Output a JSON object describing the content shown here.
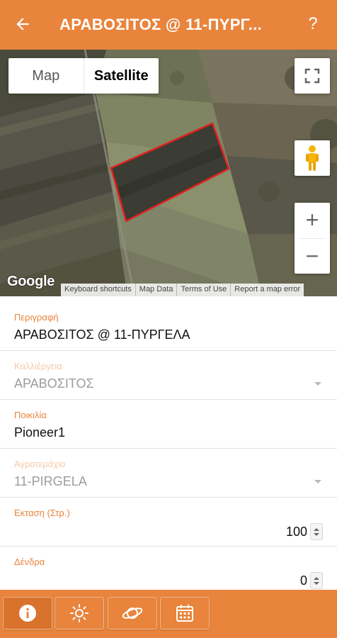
{
  "header": {
    "title": "ΑΡΑΒΟΣΙΤΟΣ @ 11-ΠΥΡΓ...",
    "back_icon": "arrow-left-icon",
    "help_label": "?"
  },
  "map": {
    "map_type_options": [
      "Map",
      "Satellite"
    ],
    "selected_map_type": "Satellite",
    "zoom_in_label": "+",
    "zoom_out_label": "−",
    "google_logo": "Google",
    "attribution_links": [
      "Keyboard shortcuts",
      "Map Data",
      "Terms of Use",
      "Report a map error"
    ],
    "field_outline_color": "#e02020"
  },
  "form": {
    "description": {
      "label": "Περιγραφή",
      "value": "ΑΡΑΒΟΣΙΤΟΣ @ 11-ΠΥΡΓΕΛΑ"
    },
    "crop": {
      "label": "Καλλιέργεια",
      "value": "ΑΡΑΒΟΣΙΤΟΣ"
    },
    "variety": {
      "label": "Ποικιλία",
      "value": "Pioneer1"
    },
    "farm_parcel": {
      "label": "Αγροτεμάχιο",
      "value": "11-PIRGELA"
    },
    "area": {
      "label": "Εκταση (Στρ.)",
      "value": "100"
    },
    "trees": {
      "label": "Δένδρα",
      "value": "0"
    }
  },
  "bottom_tabs": [
    {
      "icon": "info-icon",
      "active": true
    },
    {
      "icon": "sun-icon",
      "active": false
    },
    {
      "icon": "planet-icon",
      "active": false
    },
    {
      "icon": "calendar-icon",
      "active": false
    }
  ],
  "colors": {
    "accent": "#e8843c",
    "label_disabled": "#f5c9a6"
  }
}
